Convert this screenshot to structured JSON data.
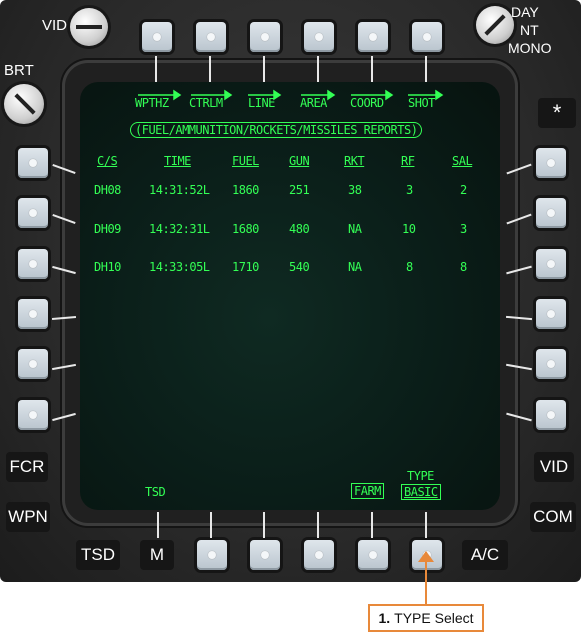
{
  "knobs": {
    "vid": "VID",
    "brt": "BRT",
    "day": "DAY",
    "nt": "NT",
    "mono": "MONO"
  },
  "top_buttons": [
    "WPTHZ",
    "CTRLM",
    "LINE",
    "AREA",
    "COORD",
    "SHOT"
  ],
  "report_title": "(FUEL/AMMUNITION/ROCKETS/MISSILES REPORTS)",
  "table": {
    "columns": [
      "C/S",
      "TIME",
      "FUEL",
      "GUN",
      "RKT",
      "RF",
      "SAL"
    ],
    "rows": [
      [
        "DH08",
        "14:31:52L",
        "1860",
        "251",
        "38",
        "3",
        "2"
      ],
      [
        "DH09",
        "14:32:31L",
        "1680",
        "480",
        "NA",
        "10",
        "3"
      ],
      [
        "DH10",
        "14:33:05L",
        "1710",
        "540",
        "NA",
        "8",
        "8"
      ]
    ]
  },
  "bottom_screen": {
    "tsd": "TSD",
    "farm": "FARM",
    "type_label": "TYPE",
    "type_value": "BASIC"
  },
  "side_buttons": {
    "star": "*",
    "fcr": "FCR",
    "wpn": "WPN",
    "vid_right": "VID",
    "com": "COM"
  },
  "bottom_buttons": {
    "tsd": "TSD",
    "m": "M",
    "ac": "A/C"
  },
  "callout": {
    "number": "1.",
    "text": "TYPE Select"
  },
  "colors": {
    "symbology": "#33ff55",
    "callout_border": "#e8893a"
  }
}
